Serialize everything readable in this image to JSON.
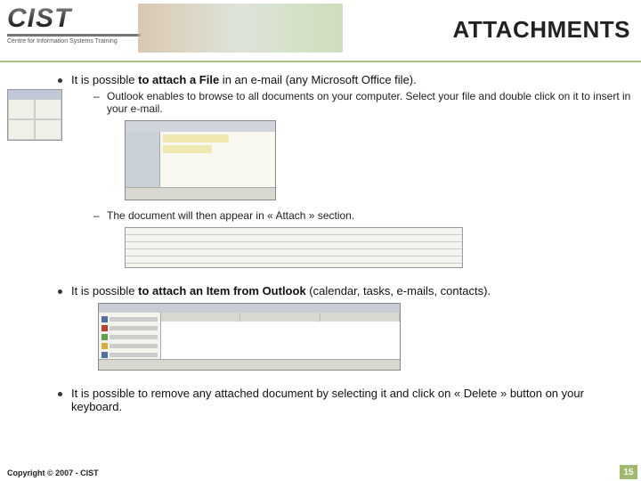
{
  "header": {
    "logo_text": "CIST",
    "logo_subtitle": "Centre for Information Systems Training",
    "title": "ATTACHMENTS"
  },
  "bullets": {
    "b1_pre": "It is possible ",
    "b1_strong": "to attach a File",
    "b1_post": " in an e-mail (any Microsoft Office file).",
    "s1": "Outlook enables to browse to all documents on your computer. Select your file and double click on it to insert in your e-mail.",
    "s2": "The document will then appear in « Attach » section.",
    "b2_pre": "It is possible ",
    "b2_strong": "to attach an Item from Outlook",
    "b2_post": " (calendar, tasks, e-mails, contacts).",
    "b3": "It is possible to remove any attached document by selecting it and click on « Delete » button on your keyboard."
  },
  "footer": {
    "copyright": "Copyright © 2007 - CIST",
    "page": "15"
  }
}
